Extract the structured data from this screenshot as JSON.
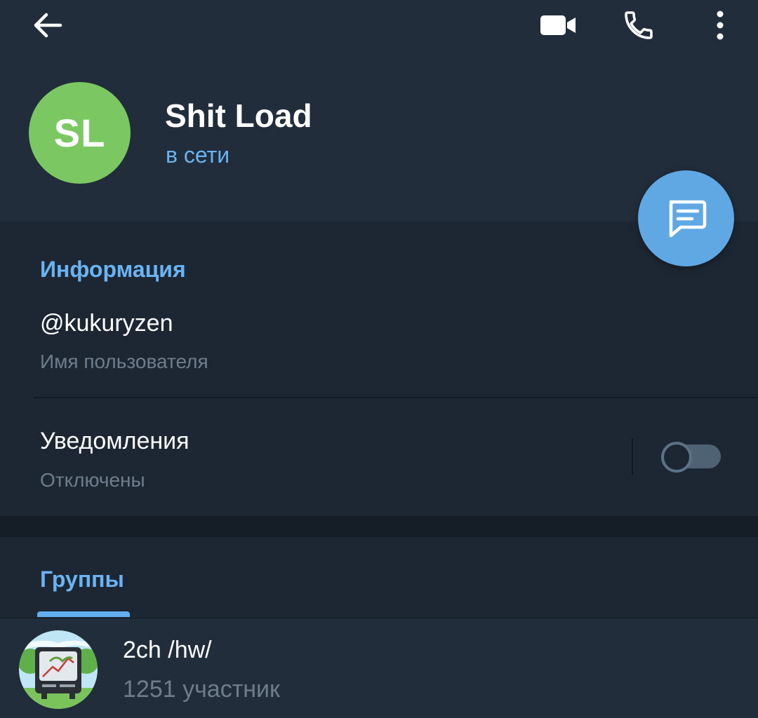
{
  "toolbar": {
    "back_icon": "arrow-left-icon",
    "video_icon": "video-camera-icon",
    "call_icon": "phone-icon",
    "more_icon": "more-vertical-icon"
  },
  "profile": {
    "initials": "SL",
    "avatar_color": "#7bc862",
    "name": "Shit Load",
    "status": "в сети",
    "fab_icon": "message-icon"
  },
  "info": {
    "title": "Информация",
    "username": "@kukuryzen",
    "username_caption": "Имя пользователя",
    "notifications_label": "Уведомления",
    "notifications_state": "Отключены",
    "notifications_enabled": false
  },
  "groups": {
    "tab_label": "Группы",
    "items": [
      {
        "name": "2ch /hw/",
        "members": "1251 участник",
        "avatar_icon": "retro-tv-icon"
      }
    ]
  },
  "colors": {
    "accent": "#6ab3f3",
    "background": "#1d2733",
    "header": "#212d3b"
  }
}
